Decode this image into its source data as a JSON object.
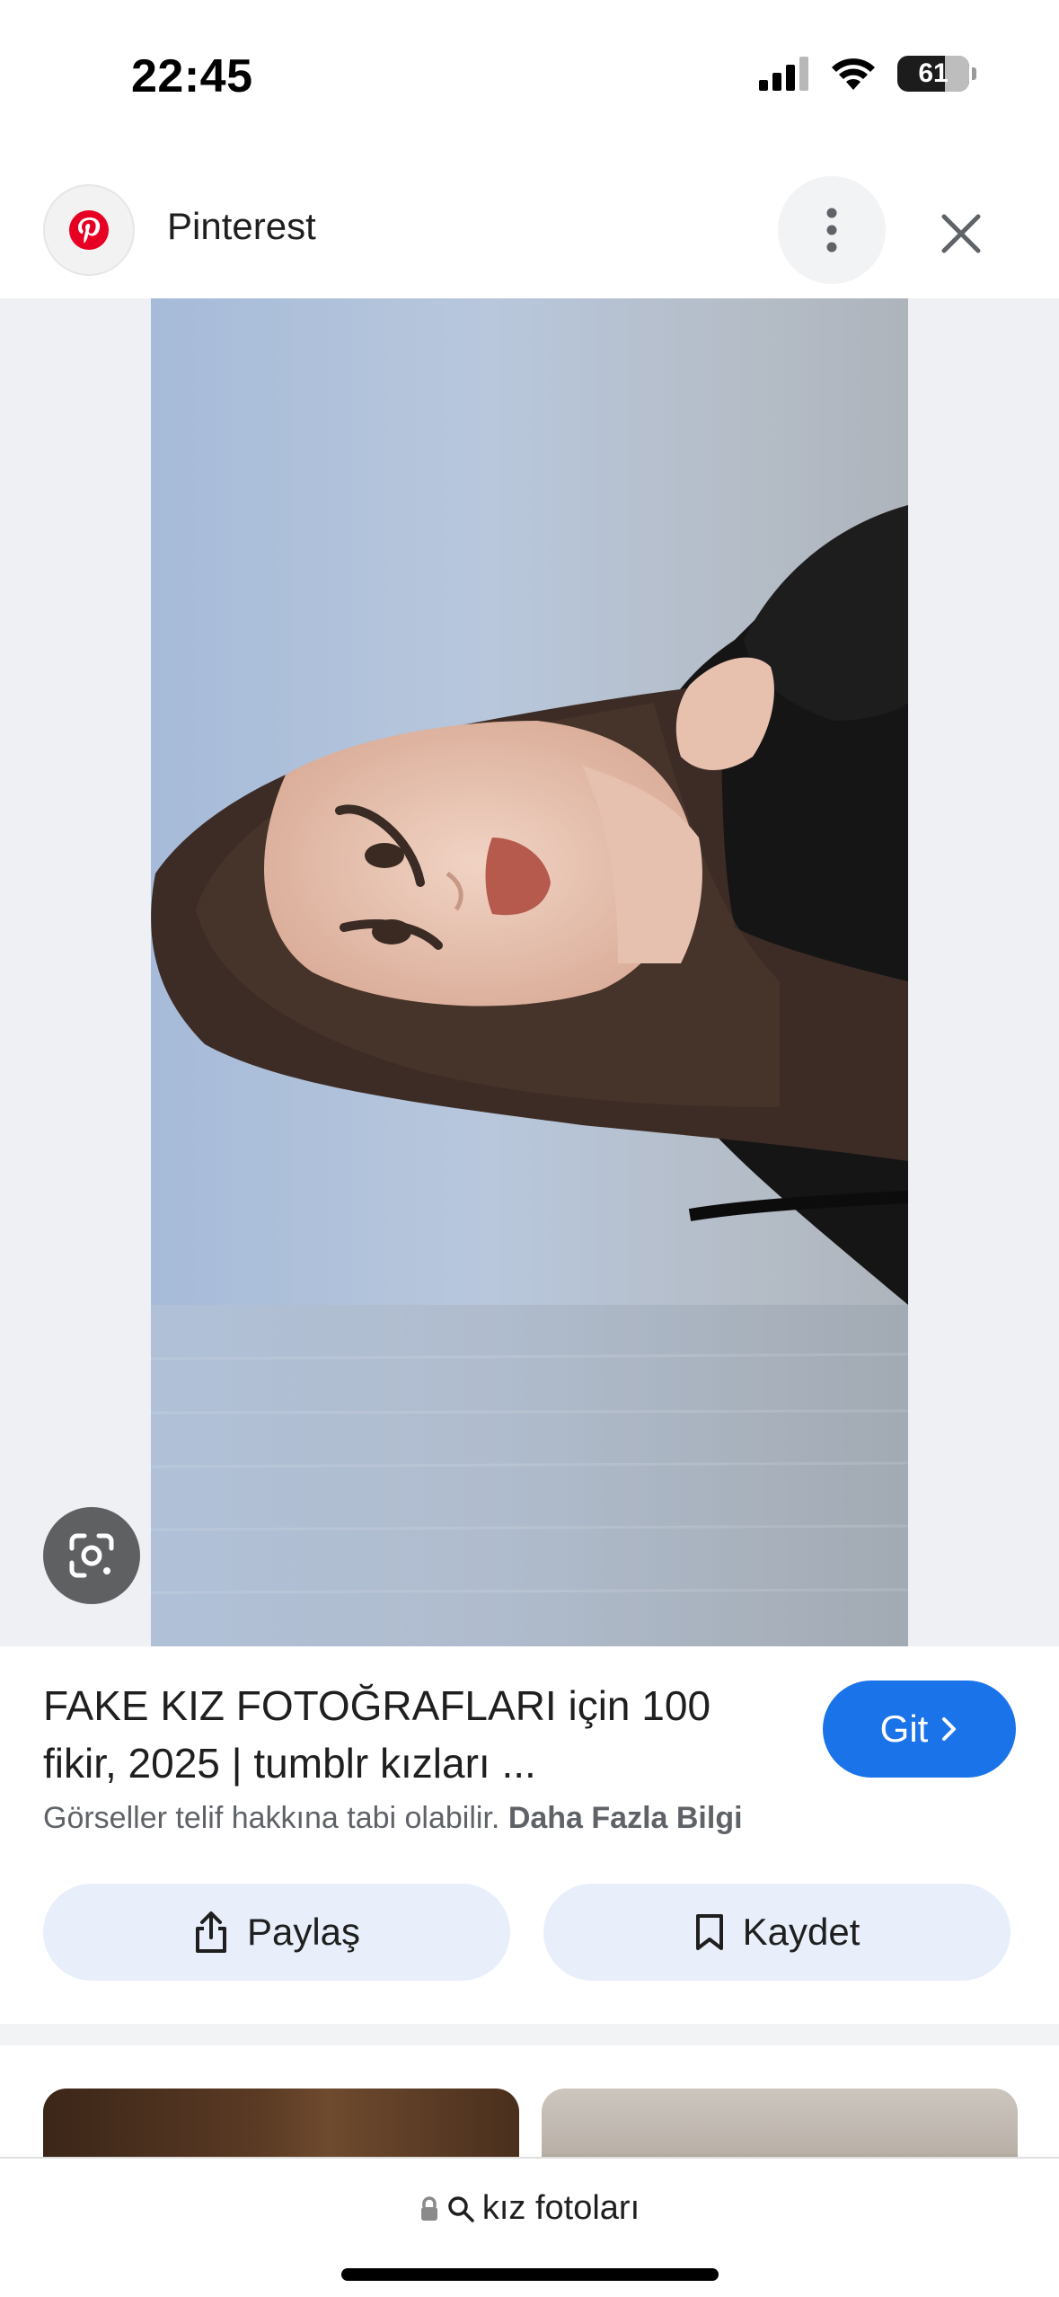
{
  "status_bar": {
    "time": "22:45",
    "battery": "61"
  },
  "header": {
    "site_name": "Pinterest",
    "logo_icon": "pinterest-logo-icon",
    "more_icon": "more-vertical-icon",
    "close_icon": "close-icon"
  },
  "image": {
    "lens_icon": "google-lens-icon"
  },
  "result": {
    "title": "FAKE KIZ FOTOĞRAFLARI için 100 fikir, 2025 | tumblr kızları ...",
    "go_label": "Git",
    "copyright_text": "Görseller telif hakkına tabi olabilir.",
    "more_info_label": "Daha Fazla Bilgi",
    "share_label": "Paylaş",
    "save_label": "Kaydet"
  },
  "address_bar": {
    "query": "kız fotoları",
    "lock_icon": "lock-icon",
    "search_icon": "search-icon"
  },
  "colors": {
    "accent": "#1a73e8",
    "action_bg": "#e8effb",
    "pinterest_red": "#e60023"
  }
}
